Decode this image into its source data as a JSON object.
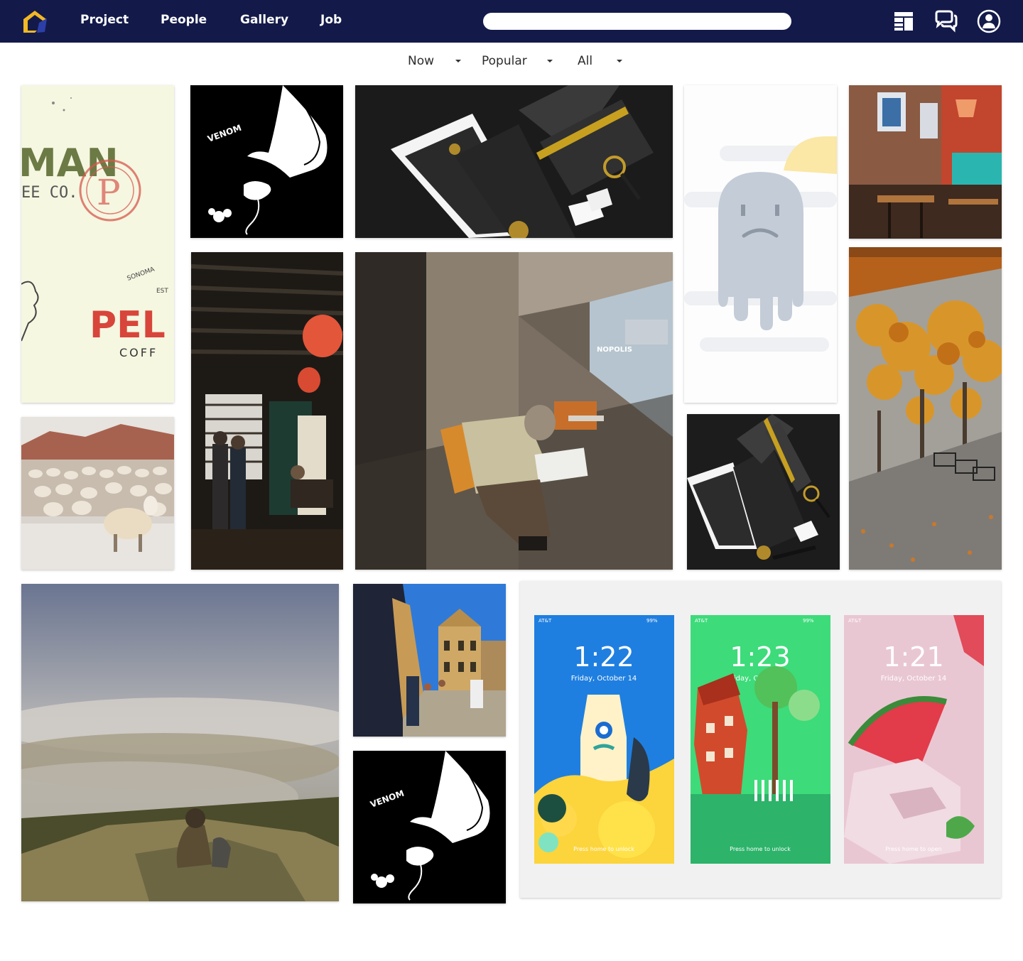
{
  "nav": {
    "links": {
      "project": "Project",
      "people": "People",
      "gallery": "Gallery",
      "job": "Job"
    },
    "search_placeholder": "",
    "icons": [
      "logo-icon",
      "layout-icon",
      "chat-icon",
      "user-account-icon"
    ]
  },
  "filters": {
    "time": "Now",
    "sort": "Popular",
    "category": "All"
  },
  "colors": {
    "nav_bg": "#131a4a",
    "logo_accent": "#f2b824",
    "logo_secondary": "#2c3fa8"
  },
  "tiles": {
    "coffee_branding": {
      "big_word": "MAN",
      "sub_word": "EE CO.",
      "red_word": "PEL",
      "small_word": "COFF",
      "sonoma": "SONOMA",
      "est": "EST"
    },
    "venom_art": {
      "label": "VENOM"
    },
    "phone_mockups": {
      "carrier": "AT&T",
      "battery": "99%",
      "screens": [
        {
          "time": "1:22",
          "date": "Friday, October 14",
          "hint": "Press home to unlock"
        },
        {
          "time": "1:23",
          "date": "Friday, October 14",
          "hint": "Press home to unlock"
        },
        {
          "time": "1:21",
          "date": "Friday, October 14",
          "hint": "Press home to open"
        }
      ]
    },
    "street_sign": "NOPOLIS"
  }
}
